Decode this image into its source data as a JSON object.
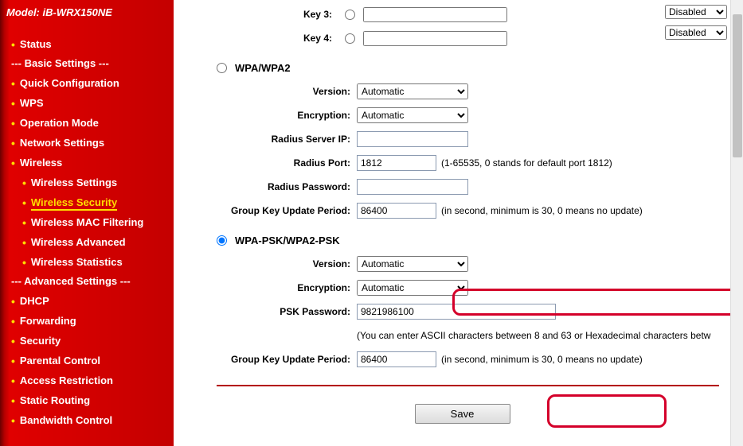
{
  "model": "Model: iB-WRX150NE",
  "sidebar": {
    "items": [
      {
        "label": "Status",
        "type": "top"
      },
      {
        "label": "--- Basic Settings ---",
        "type": "section"
      },
      {
        "label": "Quick Configuration",
        "type": "top"
      },
      {
        "label": "WPS",
        "type": "top"
      },
      {
        "label": "Operation Mode",
        "type": "top"
      },
      {
        "label": "Network Settings",
        "type": "top"
      },
      {
        "label": "Wireless",
        "type": "top"
      },
      {
        "label": "Wireless Settings",
        "type": "sub"
      },
      {
        "label": "Wireless Security",
        "type": "sub",
        "active": true
      },
      {
        "label": "Wireless MAC Filtering",
        "type": "sub"
      },
      {
        "label": "Wireless Advanced",
        "type": "sub"
      },
      {
        "label": "Wireless Statistics",
        "type": "sub"
      },
      {
        "label": "--- Advanced Settings ---",
        "type": "section"
      },
      {
        "label": "DHCP",
        "type": "top"
      },
      {
        "label": "Forwarding",
        "type": "top"
      },
      {
        "label": "Security",
        "type": "top"
      },
      {
        "label": "Parental Control",
        "type": "top"
      },
      {
        "label": "Access Restriction",
        "type": "top"
      },
      {
        "label": "Static Routing",
        "type": "top"
      },
      {
        "label": "Bandwidth Control",
        "type": "top"
      }
    ]
  },
  "wep": {
    "key3_label": "Key 3:",
    "key4_label": "Key 4:",
    "key3_value": "",
    "key4_value": "",
    "key3_state": "Disabled",
    "key4_state": "Disabled"
  },
  "wpa": {
    "section_title": "WPA/WPA2",
    "version_label": "Version:",
    "version_value": "Automatic",
    "encryption_label": "Encryption:",
    "encryption_value": "Automatic",
    "radius_ip_label": "Radius Server IP:",
    "radius_ip_value": "",
    "radius_port_label": "Radius Port:",
    "radius_port_value": "1812",
    "radius_port_hint": "(1-65535, 0 stands for default port 1812)",
    "radius_pwd_label": "Radius Password:",
    "radius_pwd_value": "",
    "gkup_label": "Group Key Update Period:",
    "gkup_value": "86400",
    "gkup_hint": "(in second, minimum is 30, 0 means no update)"
  },
  "psk": {
    "section_title": "WPA-PSK/WPA2-PSK",
    "version_label": "Version:",
    "version_value": "Automatic",
    "encryption_label": "Encryption:",
    "encryption_value": "Automatic",
    "psk_label": "PSK Password:",
    "psk_value": "9821986100",
    "psk_hint": "(You can enter ASCII characters between 8 and 63 or Hexadecimal characters betw",
    "gkup_label": "Group Key Update Period:",
    "gkup_value": "86400",
    "gkup_hint": "(in second, minimum is 30, 0 means no update)"
  },
  "save_label": "Save"
}
